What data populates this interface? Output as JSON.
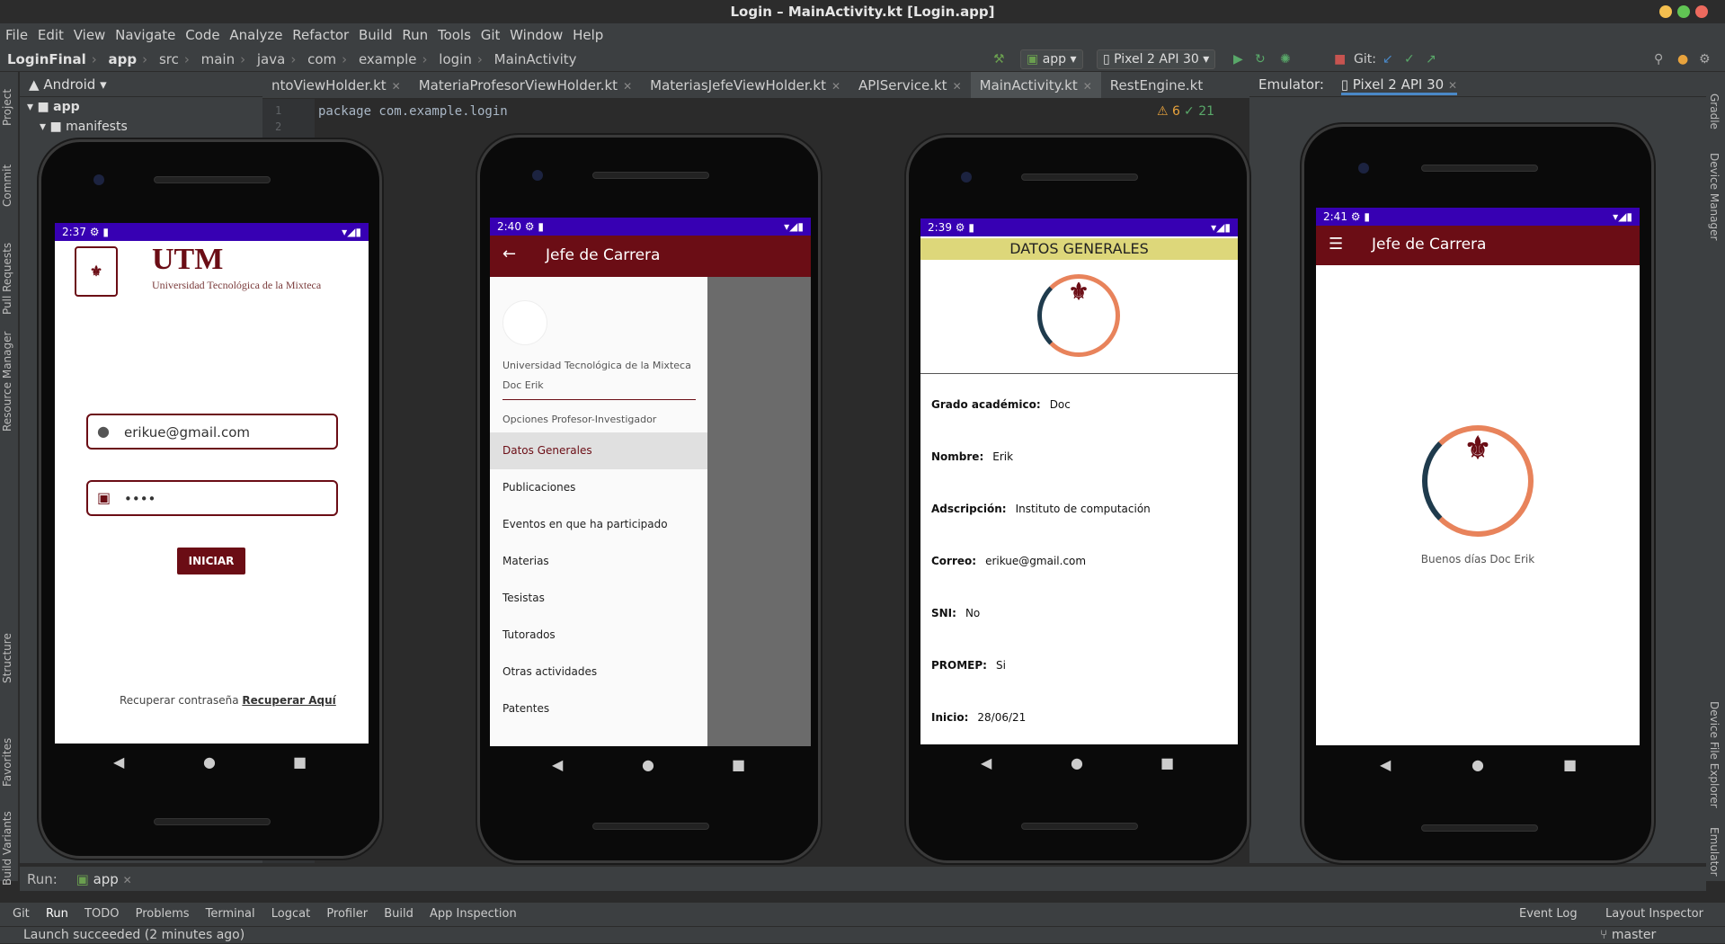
{
  "window": {
    "title": "Login – MainActivity.kt [Login.app]"
  },
  "menu": [
    "File",
    "Edit",
    "View",
    "Navigate",
    "Code",
    "Analyze",
    "Refactor",
    "Build",
    "Run",
    "Tools",
    "Git",
    "Window",
    "Help"
  ],
  "breadcrumb": [
    "LoginFinal",
    "app",
    "src",
    "main",
    "java",
    "com",
    "example",
    "login",
    "MainActivity"
  ],
  "toolbar": {
    "run_config": "app",
    "device": "Pixel 2 API 30",
    "git_label": "Git:"
  },
  "project": {
    "view": "Android",
    "tree": [
      "app",
      "manifests"
    ]
  },
  "tabs": [
    "ntoViewHolder.kt",
    "MateriaProfesorViewHolder.kt",
    "MateriasJefeViewHolder.kt",
    "APIService.kt",
    "MainActivity.kt",
    "RestEngine.kt"
  ],
  "editor": {
    "warnings": "6",
    "checks": "21",
    "line1": "package com.example.login"
  },
  "emulator": {
    "label": "Emulator:",
    "device": "Pixel 2 API 30"
  },
  "phone1": {
    "time": "2:37",
    "logo": "UTM",
    "university": "Universidad Tecnológica de la Mixteca",
    "email": "erikue@gmail.com",
    "password": "••••",
    "button": "INICIAR",
    "recover_text": "Recuperar contraseña",
    "recover_link": "Recuperar Aquí"
  },
  "phone2": {
    "time": "2:40",
    "title": "Jefe de Carrera",
    "university": "Universidad Tecnológica de la Mixteca",
    "user": "Doc Erik",
    "section": "Opciones Profesor-Investigador",
    "items": [
      "Datos Generales",
      "Publicaciones",
      "Eventos en que ha participado",
      "Materias",
      "Tesistas",
      "Tutorados",
      "Otras actividades",
      "Patentes"
    ]
  },
  "phone3": {
    "time": "2:39",
    "header": "DATOS GENERALES",
    "fields": [
      {
        "label": "Grado académico:",
        "value": "Doc"
      },
      {
        "label": "Nombre:",
        "value": "Erik"
      },
      {
        "label": "Adscripción:",
        "value": "Instituto de computación"
      },
      {
        "label": "Correo:",
        "value": "erikue@gmail.com"
      },
      {
        "label": "SNI:",
        "value": "No"
      },
      {
        "label": "PROMEP:",
        "value": "Si"
      },
      {
        "label": "Inicio:",
        "value": "28/06/21"
      }
    ]
  },
  "phone4": {
    "time": "2:41",
    "title": "Jefe de Carrera",
    "greeting": "Buenos días Doc Erik"
  },
  "run": {
    "label": "Run:",
    "config": "app"
  },
  "bottom_tabs": [
    "Git",
    "Run",
    "TODO",
    "Problems",
    "Terminal",
    "Logcat",
    "Profiler",
    "Build",
    "App Inspection"
  ],
  "bottom_right": [
    "Event Log",
    "Layout Inspector"
  ],
  "status": {
    "message": "Launch succeeded (2 minutes ago)",
    "branch": "master"
  },
  "left_tools": [
    "Project",
    "Commit",
    "Pull Requests",
    "Resource Manager",
    "Structure",
    "Favorites",
    "Build Variants"
  ],
  "right_tools": [
    "Gradle",
    "Device Manager",
    "Device File Explorer",
    "Emulator"
  ],
  "colors": {
    "maroon": "#6b0d15",
    "statusbar": "#3700b3",
    "yellow": "#ddd77a"
  }
}
